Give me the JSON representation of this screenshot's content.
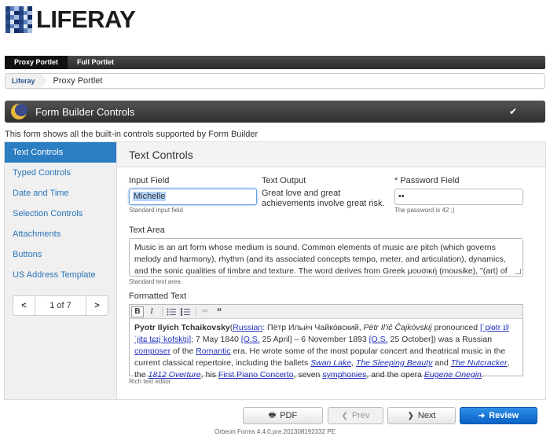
{
  "logo": {
    "text": "LIFERAY"
  },
  "nav": {
    "items": [
      "Proxy Portlet",
      "Full Portlet"
    ]
  },
  "breadcrumb": {
    "items": [
      "Liferay",
      "Proxy Portlet"
    ]
  },
  "portlet": {
    "title": "Form Builder Controls",
    "check_icon": "check-icon"
  },
  "intro": "This form shows all the built-in controls supported by Form Builder",
  "sidebar": {
    "items": [
      "Text Controls",
      "Typed Controls",
      "Date and Time",
      "Selection Controls",
      "Attachments",
      "Buttons",
      "US Address Template"
    ],
    "active_index": 0,
    "pager": {
      "prev": "<",
      "text": "1 of 7",
      "next": ">"
    }
  },
  "section": {
    "title": "Text Controls"
  },
  "fields": {
    "input_field": {
      "label": "Input Field",
      "value": "Michelle",
      "hint": "Standard input field"
    },
    "text_output": {
      "label": "Text Output",
      "value": "Great love and great achievements involve great risk."
    },
    "password": {
      "required_mark": "*",
      "label": "Password Field",
      "value": "••",
      "hint": "The password is 42 ;)"
    },
    "text_area": {
      "label": "Text Area",
      "value": "Music is an art form whose medium is sound. Common elements of music are pitch (which governs melody and harmony), rhythm (and its associated concepts tempo, meter, and articulation), dynamics, and the sonic qualities of timbre and texture. The word derives from Greek μουσική (mousike), \"(art) of the Muses\".",
      "hint": "Standard text area"
    },
    "formatted_text": {
      "label": "Formatted Text",
      "hint": "Rich text editor",
      "toolbar": [
        "B",
        "I",
        "bulleted-list-icon",
        "numbered-list-icon",
        "unlink-icon",
        "quote-icon"
      ],
      "content": {
        "name": "Pyotr Ilyich Tchaikovsky",
        "t1": "(",
        "russian": "Russian",
        "t2": ": Пётр Ильи́ч Чайко́вский, ",
        "translit": "Pëtr Il'ič Čajkóvskij",
        "t3": " pronounced ",
        "ipa": "[ˈpʲɵtr ɪlʲˈjitɕ tɕɪjˈkofskʲɪj]",
        "t4": "; 7 May 1840 ",
        "os1": "[O.S.",
        "t5": " 25 April] – 6 November 1893 ",
        "os2": "[O.S.",
        "t6": " 25 October]) was a Russian ",
        "composer": "composer",
        "t7": " of the ",
        "romantic": "Romantic",
        "t8": " era. He wrote some of the most popular concert and theatrical music in the current classical repertoire, including the ballets ",
        "swan": "Swan Lake",
        "t9": ", ",
        "sleeping": "The Sleeping Beauty",
        "t10": " and ",
        "nutcracker": "The Nutcracker",
        "t11": ", the ",
        "overture": "1812 Overture",
        "t12": ", his ",
        "concerto": "First Piano Concerto",
        "t13": ", seven ",
        "symphonies": "symphonies",
        "t14": ", and the opera ",
        "onegin": "Eugene Onegin",
        "t15": "."
      }
    }
  },
  "buttons": {
    "pdf": "PDF",
    "prev": "Prev",
    "next": "Next",
    "review": "Review"
  },
  "footer": "Orbeon Forms 4.4.0.pre.201308192332 PE"
}
